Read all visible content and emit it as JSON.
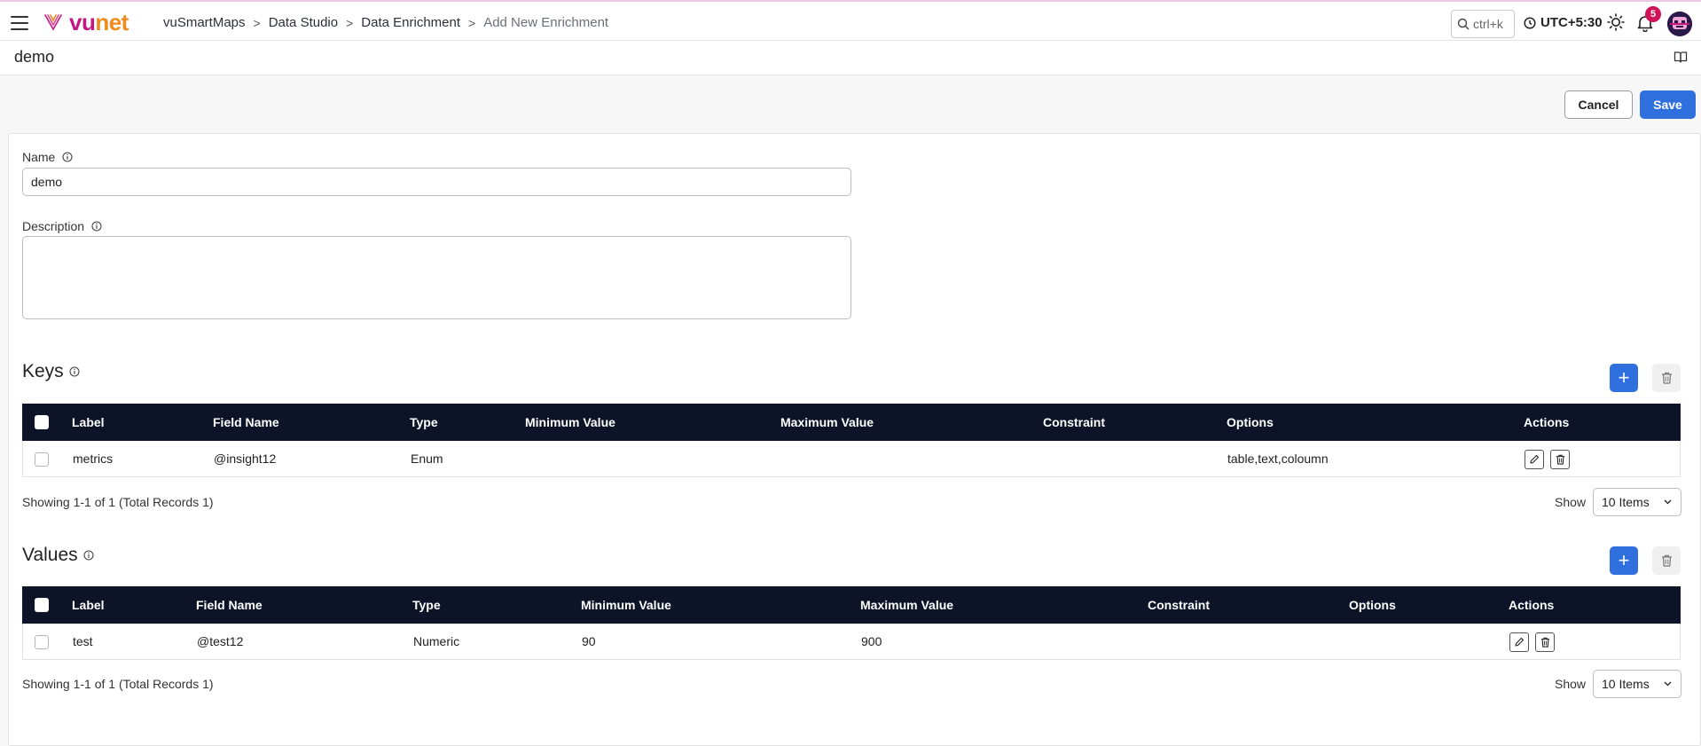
{
  "header": {
    "logo_vu": "vu",
    "logo_net": "net",
    "breadcrumb": [
      "vuSmartMaps",
      "Data Studio",
      "Data Enrichment",
      "Add New Enrichment"
    ],
    "search_placeholder": "ctrl+k",
    "timezone": "UTC+5:30",
    "notification_count": "5"
  },
  "page": {
    "title": "demo"
  },
  "actions": {
    "cancel_label": "Cancel",
    "save_label": "Save"
  },
  "form": {
    "name_label": "Name",
    "name_value": "demo",
    "description_label": "Description",
    "description_value": ""
  },
  "keys": {
    "title": "Keys",
    "columns": [
      "Label",
      "Field Name",
      "Type",
      "Minimum Value",
      "Maximum Value",
      "Constraint",
      "Options",
      "Actions"
    ],
    "rows": [
      {
        "label": "metrics",
        "field_name": "@insight12",
        "type": "Enum",
        "min": "",
        "max": "",
        "constraint": "",
        "options": "table,text,coloumn"
      }
    ],
    "showing": "Showing 1-1 of 1 (Total Records 1)",
    "show_label": "Show",
    "page_size": "10 Items"
  },
  "values": {
    "title": "Values",
    "columns": [
      "Label",
      "Field Name",
      "Type",
      "Minimum Value",
      "Maximum Value",
      "Constraint",
      "Options",
      "Actions"
    ],
    "rows": [
      {
        "label": "test",
        "field_name": "@test12",
        "type": "Numeric",
        "min": "90",
        "max": "900",
        "constraint": "",
        "options": ""
      }
    ],
    "showing": "Showing 1-1 of 1 (Total Records 1)",
    "show_label": "Show",
    "page_size": "10 Items"
  },
  "colors": {
    "primary": "#2f6fde",
    "table_header": "#0d1428",
    "brand_magenta": "#c2187f",
    "brand_orange": "#f08a1c",
    "badge": "#d1145a"
  }
}
